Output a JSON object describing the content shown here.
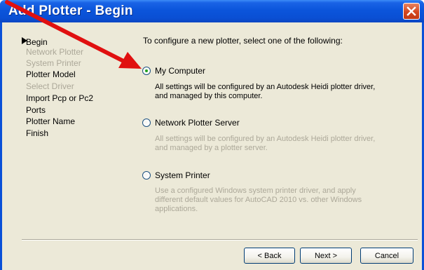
{
  "window": {
    "title": "Add Plotter - Begin"
  },
  "steps": [
    {
      "label": "Begin",
      "state": "current"
    },
    {
      "label": "Network Plotter",
      "state": "disabled"
    },
    {
      "label": "System Printer",
      "state": "disabled"
    },
    {
      "label": "Plotter Model",
      "state": "enabled"
    },
    {
      "label": "Select Driver",
      "state": "disabled"
    },
    {
      "label": "Import Pcp or Pc2",
      "state": "enabled"
    },
    {
      "label": "Ports",
      "state": "enabled"
    },
    {
      "label": "Plotter Name",
      "state": "enabled"
    },
    {
      "label": "Finish",
      "state": "enabled"
    }
  ],
  "intro": "To configure a new plotter, select one of the following:",
  "options": [
    {
      "label": "My Computer",
      "checked": true,
      "description": "All settings will be configured by an Autodesk Heidi plotter driver, and managed by this computer."
    },
    {
      "label": "Network Plotter Server",
      "checked": false,
      "description": "All settings will be configured by an Autodesk Heidi plotter driver, and managed by a plotter server."
    },
    {
      "label": "System Printer",
      "checked": false,
      "description": "Use a configured Windows system printer driver, and apply different default values for AutoCAD 2010 vs. other Windows applications."
    }
  ],
  "buttons": {
    "back": "< Back",
    "next": "Next >",
    "cancel": "Cancel"
  },
  "annotation": {
    "arrow_color": "#e01010"
  },
  "colors": {
    "titlebar": "#0a50d8",
    "dialog_bg": "#ece9d8",
    "disabled_text": "#aca899",
    "close_button": "#d4471f"
  }
}
